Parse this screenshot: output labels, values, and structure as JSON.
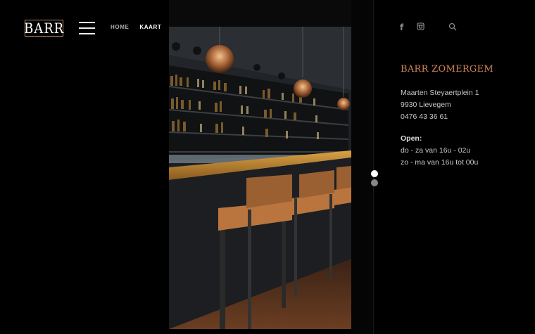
{
  "header": {
    "logo_text": "BARR",
    "nav": [
      {
        "label": "HOME",
        "active": false
      },
      {
        "label": "KAART",
        "active": true
      }
    ]
  },
  "icons": {
    "facebook": "facebook-icon",
    "instagram": "instagram-icon",
    "search": "search-icon",
    "menu": "hamburger-menu-icon"
  },
  "slider": {
    "total": 2,
    "current": 1
  },
  "venue": {
    "name": "BARR ZOMERGEM",
    "address_line1": "Maarten Steyaertplein 1",
    "address_line2": "9930 Lievegem",
    "phone": "0476 43 36 61",
    "open_label": "Open:",
    "hours_1": "do - za van 16u - 02u",
    "hours_2": "zo - ma van 16u tot 00u"
  },
  "colors": {
    "accent": "#d0845a",
    "background": "#000000"
  }
}
